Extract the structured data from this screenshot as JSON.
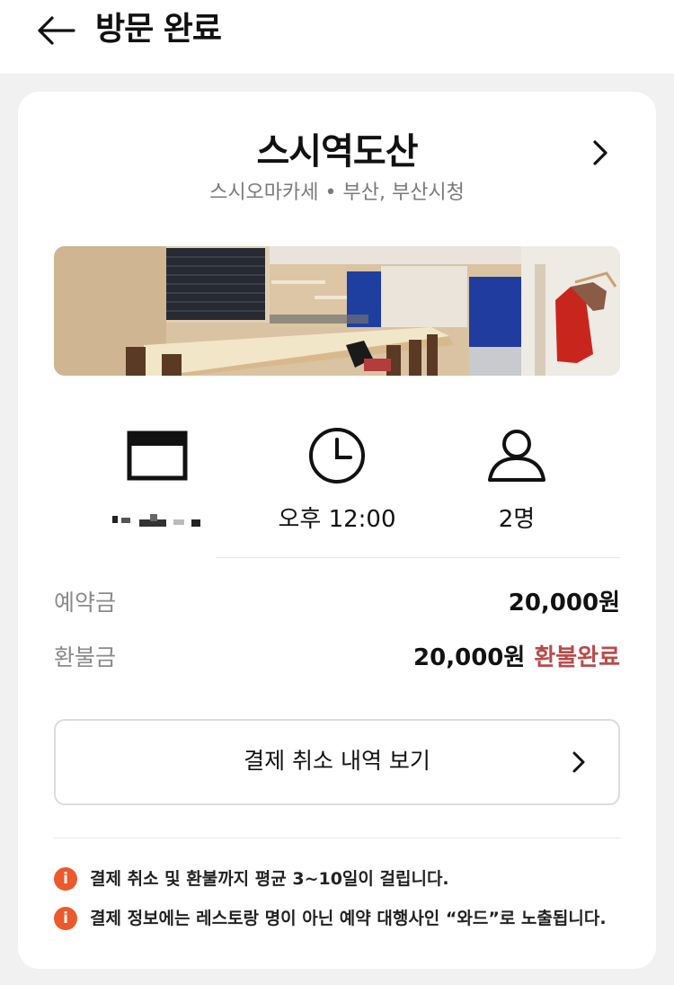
{
  "header": {
    "title": "방문 완료",
    "back_icon": "arrow-left-icon"
  },
  "restaurant": {
    "name": "스시역도산",
    "subtitle": "스시오마카세 • 부산, 부산시청",
    "chevron_icon": "chevron-right-icon",
    "photo_icon": "restaurant-photo"
  },
  "reservation": {
    "date_icon": "calendar-icon",
    "date_value": "",
    "time_icon": "clock-icon",
    "time_value": "오후 12:00",
    "party_icon": "person-icon",
    "party_value": "2명"
  },
  "payment": {
    "deposit_label": "예약금",
    "deposit_value": "20,000원",
    "refund_label": "환불금",
    "refund_value": "20,000원",
    "refund_status": "환불완료",
    "refund_status_color": "#b84c4a"
  },
  "history_button": {
    "label": "결제 취소 내역 보기"
  },
  "notices": [
    {
      "icon": "info-icon",
      "text": "결제 취소 및 환불까지 평균 3~10일이 걸립니다."
    },
    {
      "icon": "info-icon",
      "text": "결제 정보에는 레스토랑 명이 아닌 예약 대행사인 “와드”로 노출됩니다."
    }
  ],
  "colors": {
    "accent_notice": "#ea5a2c",
    "background": "#f1f1f1"
  }
}
